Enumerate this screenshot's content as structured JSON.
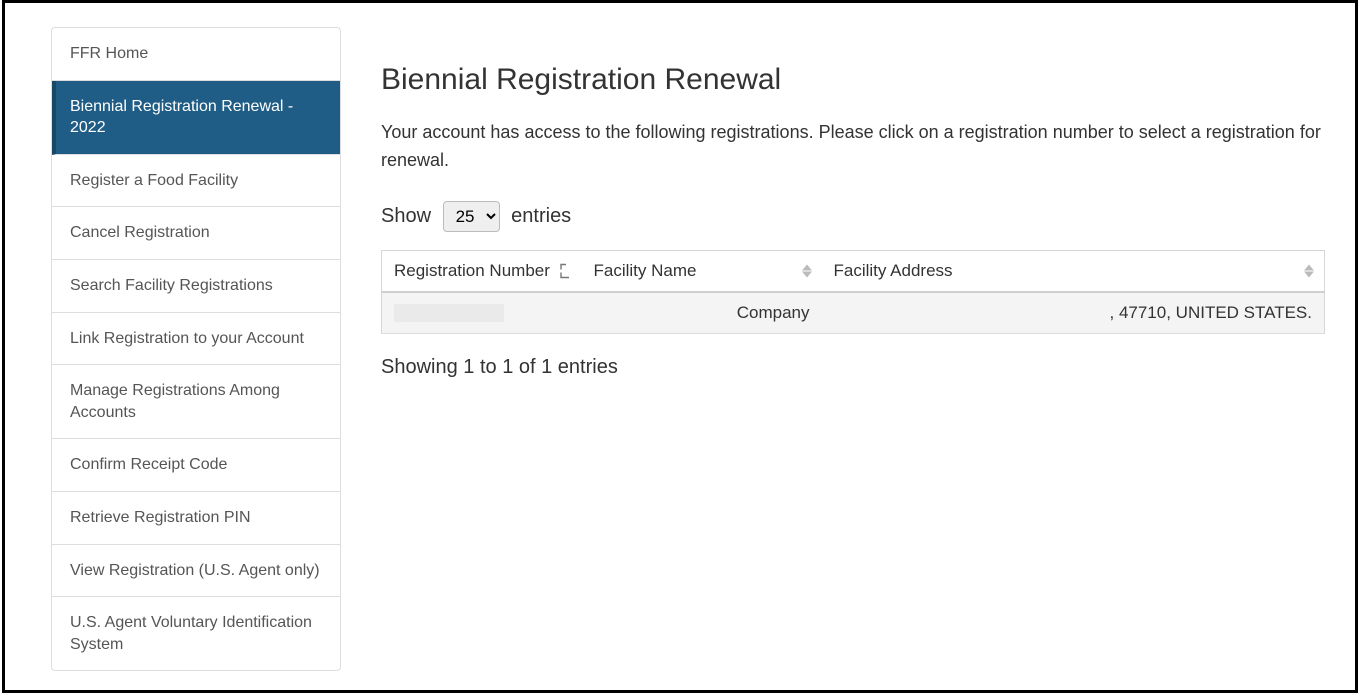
{
  "sidebar": {
    "items": [
      {
        "label": "FFR Home",
        "active": false
      },
      {
        "label": "Biennial Registration Renewal - 2022",
        "active": true
      },
      {
        "label": "Register a Food Facility",
        "active": false
      },
      {
        "label": "Cancel Registration",
        "active": false
      },
      {
        "label": "Search Facility Registrations",
        "active": false
      },
      {
        "label": "Link Registration to your Account",
        "active": false
      },
      {
        "label": "Manage Registrations Among Accounts",
        "active": false
      },
      {
        "label": "Confirm Receipt Code",
        "active": false
      },
      {
        "label": "Retrieve Registration PIN",
        "active": false
      },
      {
        "label": "View Registration (U.S. Agent only)",
        "active": false
      },
      {
        "label": "U.S. Agent Voluntary Identification System",
        "active": false
      }
    ]
  },
  "page": {
    "title": "Biennial Registration Renewal",
    "intro": "Your account has access to the following registrations. Please click on a registration number to select a registration for renewal."
  },
  "entries_control": {
    "label_before": "Show",
    "label_after": "entries",
    "selected": "25",
    "options": [
      "25"
    ]
  },
  "table": {
    "columns": [
      {
        "label": "Registration Number",
        "sorted": "asc"
      },
      {
        "label": "Facility Name",
        "sorted": "none"
      },
      {
        "label": "Facility Address",
        "sorted": "none"
      }
    ],
    "rows": [
      {
        "registration_number": "",
        "facility_name_suffix": "Company",
        "facility_address_suffix": ", 47710, UNITED STATES."
      }
    ]
  },
  "info": "Showing 1 to 1 of 1 entries"
}
